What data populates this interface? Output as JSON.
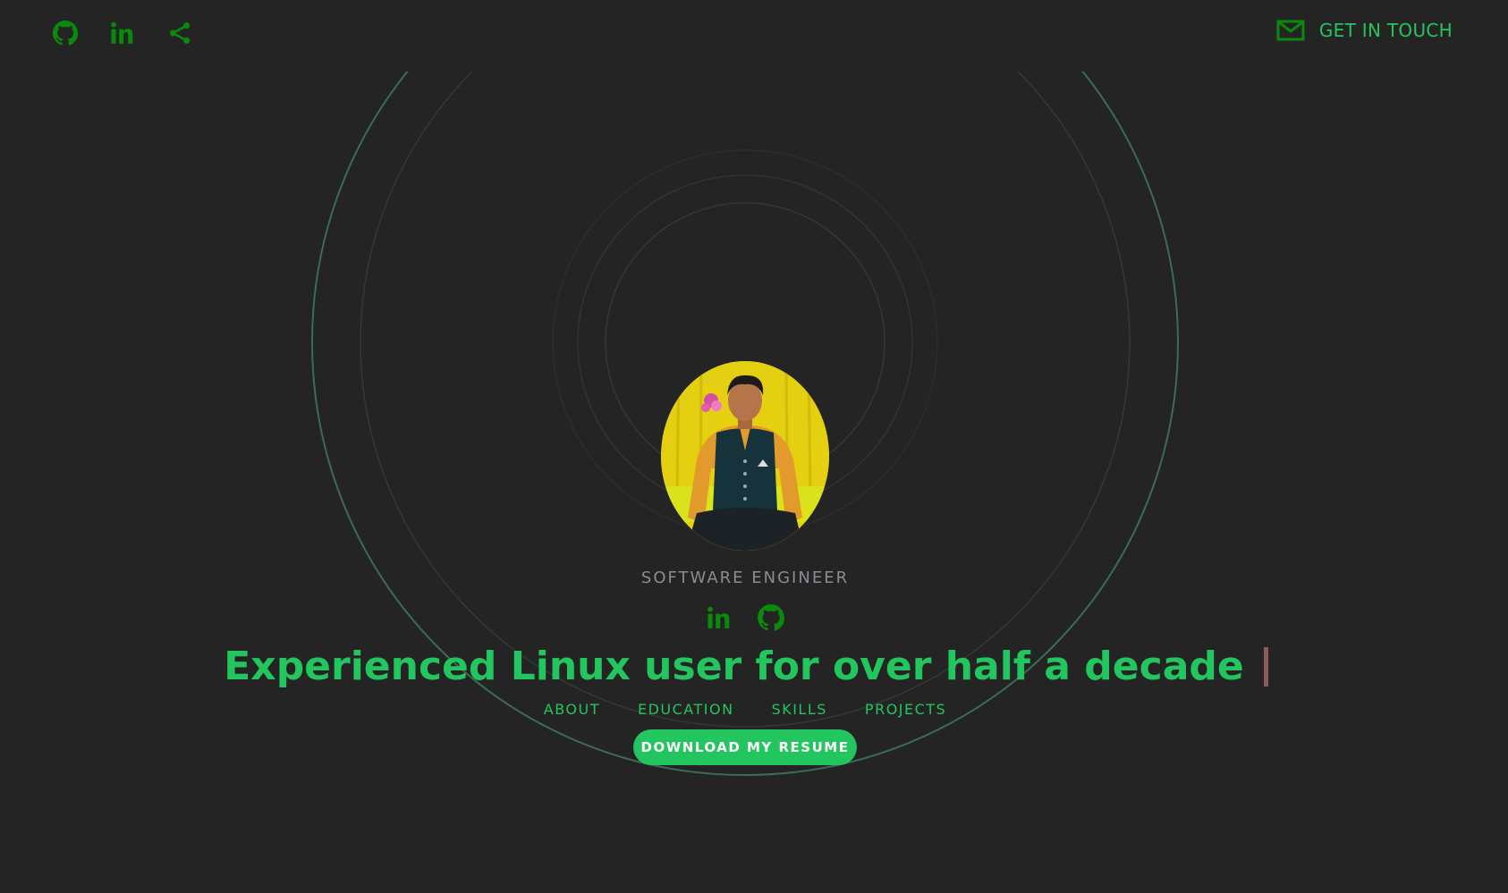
{
  "header": {
    "social_icons": [
      "github-icon",
      "linkedin-icon",
      "share-icon"
    ],
    "contact_label": "GET IN TOUCH",
    "contact_icon": "mail-icon"
  },
  "hero": {
    "role": "SOFTWARE ENGINEER",
    "social_icons": [
      "linkedin-icon",
      "github-icon"
    ],
    "headline": "Experienced Linux user for over half a decade",
    "nav": [
      "ABOUT",
      "EDUCATION",
      "SKILLS",
      "PROJECTS"
    ],
    "resume_button": "DOWNLOAD MY RESUME"
  },
  "colors": {
    "background": "#242424",
    "accent": "#22c55e",
    "icon_green": "#0a8a0a",
    "muted_text": "#8b8b94",
    "cursor": "#8a5a60"
  }
}
